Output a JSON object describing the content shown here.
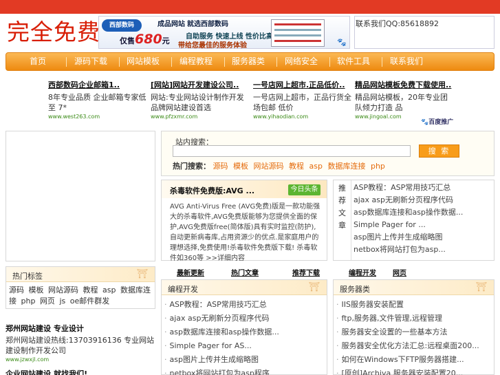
{
  "header": {
    "logo_text": "完全免费",
    "contact": "联系我们QQ:85618892"
  },
  "banner": {
    "brand": "西部数码",
    "title": "成品网站",
    "title_suffix": "就选西部数码",
    "sub": "自助服务 快速上线 性价比高",
    "price_prefix": "仅售",
    "price": "680",
    "price_unit": "元",
    "slogan": "带给您最佳的服务体验"
  },
  "nav": {
    "items": [
      "首页",
      "源码下载",
      "网站模板",
      "编程教程",
      "服务器类",
      "网络安全",
      "软件工具",
      "联系我们"
    ]
  },
  "ads": [
    {
      "title": "西部数码企业邮箱1..",
      "desc": "8年专业品质 企业邮箱专家低至 7*",
      "url": "www.west263.com"
    },
    {
      "title": "[网站]网站开发建设公司..",
      "desc": "网站:专业网站设计制作开发 品牌网站建设首选",
      "url": "www.pfzxmr.com"
    },
    {
      "title": "一号店网上超市.正品低价..",
      "desc": "一号店网上超市，正品行货全场包邮 低价",
      "url": "www.yihaodian.com"
    },
    {
      "title": "精品网站模板免费下载使用..",
      "desc": "精品网站模板，20年专业团队倾力打造 品",
      "url": "www.jingoal.com"
    }
  ],
  "baidu": "百度推广",
  "search": {
    "label": "站内搜索：",
    "placeholder": "",
    "button": "搜 索",
    "hot_label": "热门搜索：",
    "hot_terms": [
      "源码",
      "模板",
      "网站源码",
      "教程",
      "asp",
      "数据库连接",
      "php"
    ]
  },
  "headline": {
    "title": "杀毒软件免费版:AVG ...",
    "tag": "今日头条",
    "body": "AVG Anti-Virus Free (AVG免费)版是一款功能强大的杀毒软件,AVG免费版能够为您提供全面的保护,AVG免费版free(简体版)具有实时监控(防护),自动更新病毒库,占用资源少的优点.是家庭用户的理想选择,免费使用!杀毒软件免费版下载! 杀毒软件如360等 >>详细内容"
  },
  "right_list": {
    "head": [
      "推荐",
      "文章"
    ],
    "items": [
      "ASP教程：ASP常用技巧汇总",
      "ajax asp无刷新分页程序代码",
      "asp数据库连接和asp操作数据...",
      "Simple Pager for ...",
      "asp图片上传并生成缩略图",
      "netbox将网站打包为asp..."
    ]
  },
  "tabs": [
    "最新更新",
    "热门文章",
    "推荐下载",
    "编程开发",
    "网页"
  ],
  "tag_box": {
    "title": "热门标签",
    "tags": [
      "源码",
      "模板",
      "网站源码",
      "教程",
      "asp",
      "数据库连接",
      "php",
      "网页",
      "js",
      "oe邮件群发"
    ]
  },
  "box_left": {
    "title": "编程开发",
    "items": [
      "ASP教程：ASP常用技巧汇总",
      "ajax asp无刷新分页程序代码",
      "asp数据库连接和asp操作数据...",
      "Simple Pager for AS...",
      "asp图片上传并生成缩略图",
      "netbox将网站打包为asp程序"
    ]
  },
  "box_right": {
    "title": "服务器类",
    "items": [
      "IIS服务器安装配置",
      "ftp,服务器,文件管理,远程管理",
      "服务器安全设置的一些基本方法",
      "服务器安全优化方法汇总:远程桌面200...",
      "如何在Windows下FTP服务器搭建...",
      "[原创]Archiva 服务器安装配置20..."
    ]
  },
  "bottom_ad": {
    "title": "郑州网站建设 专业设计",
    "desc": "郑州网站建设热线:13703916136 专业网站建设制作开发公司",
    "url": "www.jzwxjl.com",
    "title2": "企业网站建设,就找我们!"
  }
}
